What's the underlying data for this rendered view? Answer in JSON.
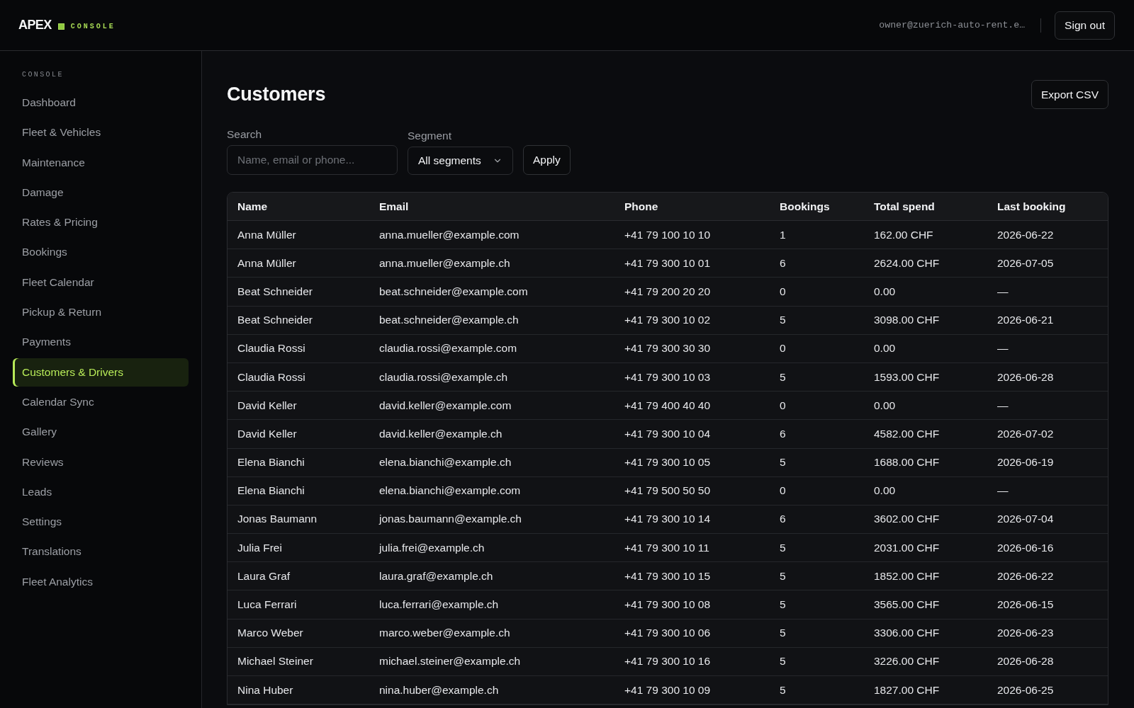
{
  "header": {
    "logo": {
      "wordmark": "APEX",
      "tag": "CONSOLE"
    },
    "user_email": "owner@zuerich-auto-rent.e…",
    "sign_out_button": "Sign out"
  },
  "sidebar": {
    "section_label": "CONSOLE",
    "items": [
      {
        "label": "Dashboard",
        "selected": false
      },
      {
        "label": "Fleet & Vehicles",
        "selected": false
      },
      {
        "label": "Maintenance",
        "selected": false
      },
      {
        "label": "Damage",
        "selected": false
      },
      {
        "label": "Rates & Pricing",
        "selected": false
      },
      {
        "label": "Bookings",
        "selected": false
      },
      {
        "label": "Fleet Calendar",
        "selected": false
      },
      {
        "label": "Pickup & Return",
        "selected": false
      },
      {
        "label": "Payments",
        "selected": false
      },
      {
        "label": "Customers & Drivers",
        "selected": true
      },
      {
        "label": "Calendar Sync",
        "selected": false
      },
      {
        "label": "Gallery",
        "selected": false
      },
      {
        "label": "Reviews",
        "selected": false
      },
      {
        "label": "Leads",
        "selected": false
      },
      {
        "label": "Settings",
        "selected": false
      },
      {
        "label": "Translations",
        "selected": false
      },
      {
        "label": "Fleet Analytics",
        "selected": false
      }
    ]
  },
  "page": {
    "title": "Customers",
    "export_button": "Export CSV"
  },
  "filters": {
    "search": {
      "label": "Search",
      "placeholder": "Name, email or phone..."
    },
    "segment": {
      "label": "Segment",
      "value": "All segments"
    },
    "apply_button": "Apply"
  },
  "table": {
    "columns": [
      "Name",
      "Email",
      "Phone",
      "Bookings",
      "Total spend",
      "Last booking"
    ],
    "rows": [
      [
        "Anna Müller",
        "anna.mueller@example.com",
        "+41 79 100 10 10",
        "1",
        "162.00 CHF",
        "2026-06-22"
      ],
      [
        "Anna Müller",
        "anna.mueller@example.ch",
        "+41 79 300 10 01",
        "6",
        "2624.00 CHF",
        "2026-07-05"
      ],
      [
        "Beat Schneider",
        "beat.schneider@example.com",
        "+41 79 200 20 20",
        "0",
        "0.00",
        "—"
      ],
      [
        "Beat Schneider",
        "beat.schneider@example.ch",
        "+41 79 300 10 02",
        "5",
        "3098.00 CHF",
        "2026-06-21"
      ],
      [
        "Claudia Rossi",
        "claudia.rossi@example.com",
        "+41 79 300 30 30",
        "0",
        "0.00",
        "—"
      ],
      [
        "Claudia Rossi",
        "claudia.rossi@example.ch",
        "+41 79 300 10 03",
        "5",
        "1593.00 CHF",
        "2026-06-28"
      ],
      [
        "David Keller",
        "david.keller@example.com",
        "+41 79 400 40 40",
        "0",
        "0.00",
        "—"
      ],
      [
        "David Keller",
        "david.keller@example.ch",
        "+41 79 300 10 04",
        "6",
        "4582.00 CHF",
        "2026-07-02"
      ],
      [
        "Elena Bianchi",
        "elena.bianchi@example.ch",
        "+41 79 300 10 05",
        "5",
        "1688.00 CHF",
        "2026-06-19"
      ],
      [
        "Elena Bianchi",
        "elena.bianchi@example.com",
        "+41 79 500 50 50",
        "0",
        "0.00",
        "—"
      ],
      [
        "Jonas Baumann",
        "jonas.baumann@example.ch",
        "+41 79 300 10 14",
        "6",
        "3602.00 CHF",
        "2026-07-04"
      ],
      [
        "Julia Frei",
        "julia.frei@example.ch",
        "+41 79 300 10 11",
        "5",
        "2031.00 CHF",
        "2026-06-16"
      ],
      [
        "Laura Graf",
        "laura.graf@example.ch",
        "+41 79 300 10 15",
        "5",
        "1852.00 CHF",
        "2026-06-22"
      ],
      [
        "Luca Ferrari",
        "luca.ferrari@example.ch",
        "+41 79 300 10 08",
        "5",
        "3565.00 CHF",
        "2026-06-15"
      ],
      [
        "Marco Weber",
        "marco.weber@example.ch",
        "+41 79 300 10 06",
        "5",
        "3306.00 CHF",
        "2026-06-23"
      ],
      [
        "Michael Steiner",
        "michael.steiner@example.ch",
        "+41 79 300 10 16",
        "5",
        "3226.00 CHF",
        "2026-06-28"
      ],
      [
        "Nina Huber",
        "nina.huber@example.ch",
        "+41 79 300 10 09",
        "5",
        "1827.00 CHF",
        "2026-06-25"
      ]
    ]
  }
}
